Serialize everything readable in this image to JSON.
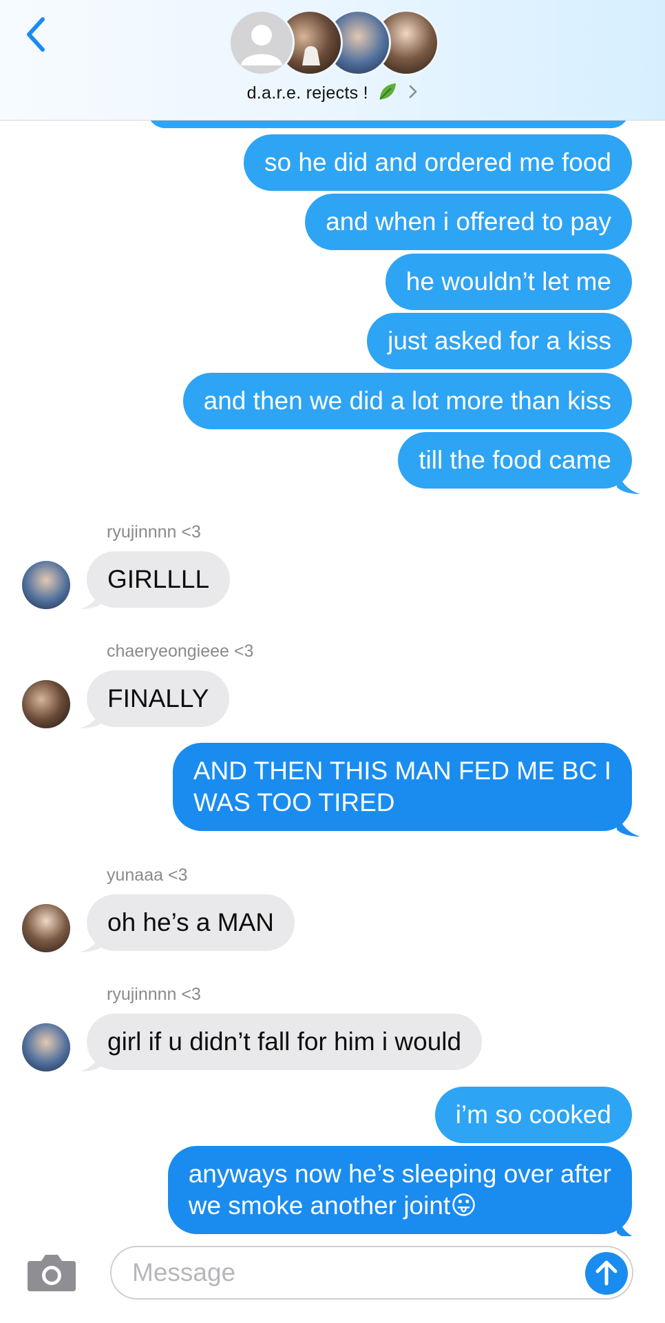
{
  "header": {
    "group_name": "d.a.r.e. rejects !",
    "icons": [
      "back-chevron-icon",
      "leaf-emoji",
      "chevron-right-icon"
    ]
  },
  "messages": [
    {
      "type": "sent",
      "text": "so he did and ordered me food"
    },
    {
      "type": "sent",
      "text": "and when i offered to pay"
    },
    {
      "type": "sent",
      "text": "he wouldn’t let me"
    },
    {
      "type": "sent",
      "text": "just asked for a kiss"
    },
    {
      "type": "sent",
      "text": "and then we did a lot more than kiss"
    },
    {
      "type": "sent",
      "text": "till the food came"
    },
    {
      "type": "received",
      "sender": "ryujinnnn <3",
      "text": "GIRLLLL"
    },
    {
      "type": "received",
      "sender": "chaeryeongieee <3",
      "text": "FINALLY"
    },
    {
      "type": "sent",
      "text_lines": [
        "AND THEN THIS MAN FED ME BC I",
        "WAS TOO TIRED"
      ]
    },
    {
      "type": "received",
      "sender": "yunaaa <3",
      "text": "oh he’s a MAN"
    },
    {
      "type": "received",
      "sender": "ryujinnnn <3",
      "text": "girl if u didn’t fall for him i would"
    },
    {
      "type": "sent",
      "text": "i’m so cooked"
    },
    {
      "type": "sent",
      "text_lines": [
        "anyways now he’s sleeping over after",
        "we smoke another joint"
      ],
      "emoji": "😛"
    }
  ],
  "composer": {
    "placeholder": "Message",
    "icons": [
      "camera-icon",
      "send-arrow-icon"
    ]
  },
  "colors": {
    "sent_bubble": "#2ea4f4",
    "sent_bubble_dark": "#1a8cf0",
    "received_bubble": "#e9e9eb",
    "accent": "#1a8cf0"
  }
}
